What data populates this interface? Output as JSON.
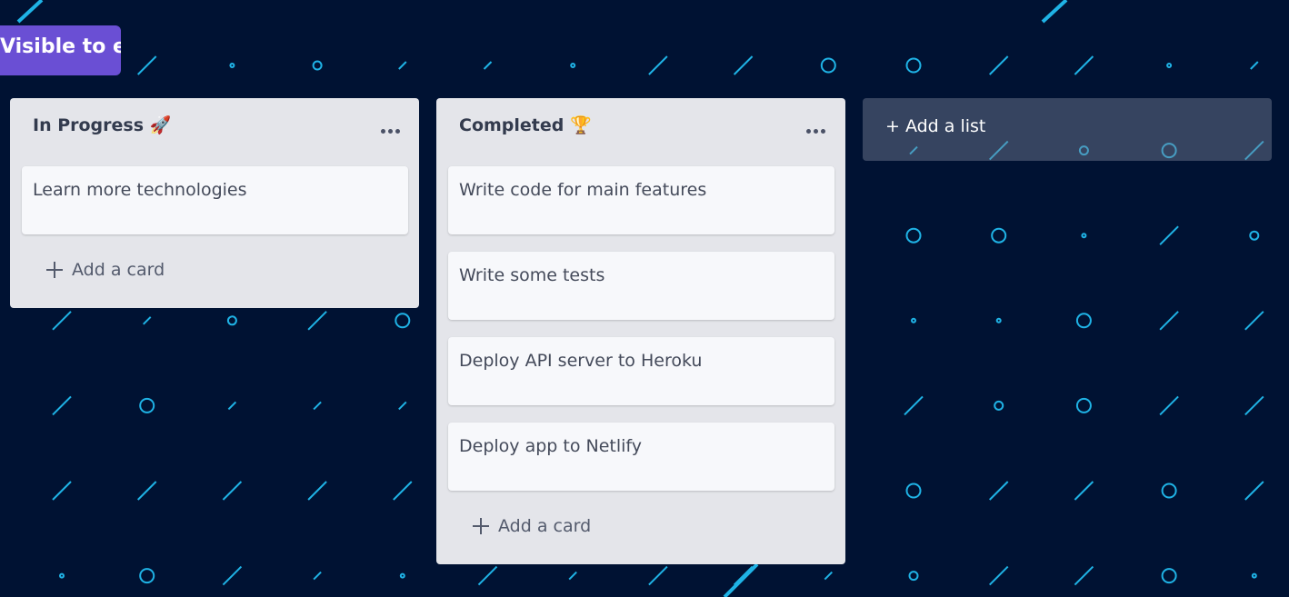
{
  "board": {
    "visibility_label": "Visible to everyone | Edit by public"
  },
  "lists": [
    {
      "title": "In Progress 🚀",
      "cards": [
        "Learn more technologies"
      ],
      "add_card_label": "Add a card"
    },
    {
      "title": "Completed 🏆",
      "cards": [
        "Write code for main features",
        "Write some tests",
        "Deploy API server to Heroku",
        "Deploy app to Netlify"
      ],
      "add_card_label": "Add a card"
    }
  ],
  "add_list_label": "+ Add a list",
  "colors": {
    "background": "#001233",
    "pattern": "#1fb3e6",
    "visibility_badge": "#6a4fd4",
    "list_background": "#e4e5ea",
    "card_background": "#f7f8fb"
  },
  "icons": {
    "list_menu": "more-horizontal-icon",
    "add_card": "plus-icon"
  }
}
